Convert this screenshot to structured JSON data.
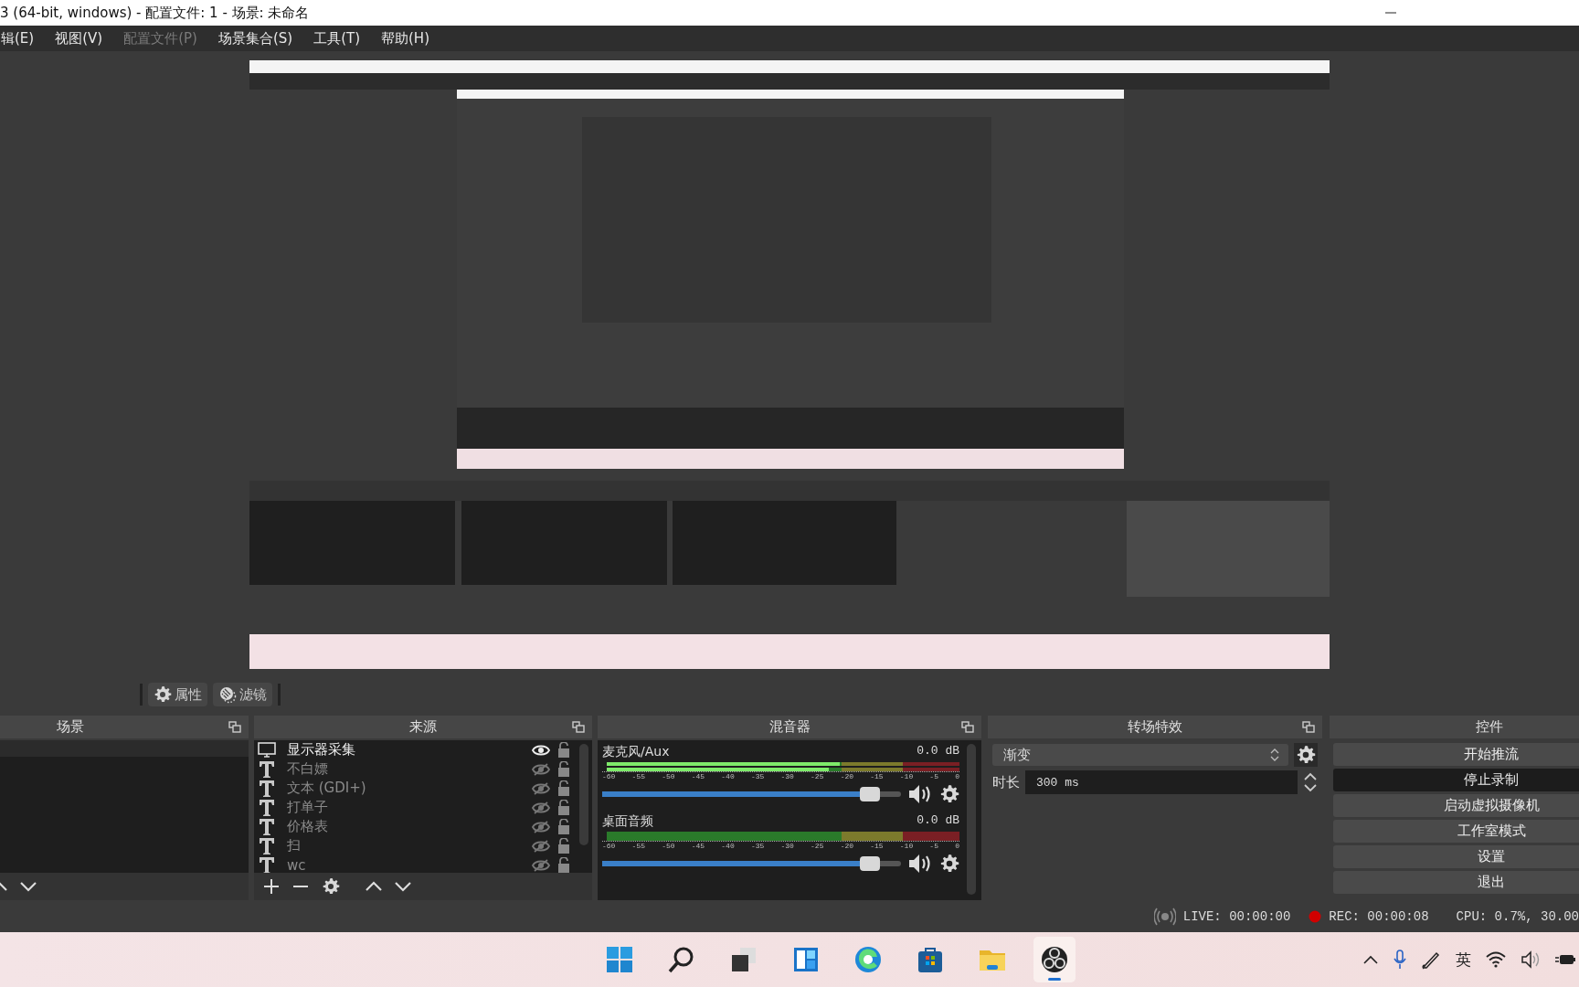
{
  "window": {
    "title": "3 (64-bit, windows) - 配置文件: 1 - 场景: 未命名"
  },
  "menu": [
    {
      "label": "辑(E)",
      "disabled": false
    },
    {
      "label": "视图(V)",
      "disabled": false
    },
    {
      "label": "配置文件(P)",
      "disabled": true
    },
    {
      "label": "场景集合(S)",
      "disabled": false
    },
    {
      "label": "工具(T)",
      "disabled": false
    },
    {
      "label": "帮助(H)",
      "disabled": false
    }
  ],
  "toolbar": [
    {
      "label": "属性",
      "kind": "gear"
    },
    {
      "label": "滤镜",
      "kind": "filter"
    }
  ],
  "scenes": {
    "title": "场景"
  },
  "sources": {
    "title": "来源",
    "items": [
      {
        "name": "显示器采集",
        "kind": "display",
        "visible": true
      },
      {
        "name": "不白嫖",
        "kind": "text",
        "visible": false
      },
      {
        "name": "文本 (GDI+)",
        "kind": "text",
        "visible": false
      },
      {
        "name": "打单子",
        "kind": "text",
        "visible": false
      },
      {
        "name": "价格表",
        "kind": "text",
        "visible": false
      },
      {
        "name": "扫",
        "kind": "text",
        "visible": false
      },
      {
        "name": "wc",
        "kind": "text",
        "visible": false
      }
    ]
  },
  "mixer": {
    "title": "混音器",
    "channels": [
      {
        "name": "麦克风/Aux",
        "reading": "0.0 dB",
        "meters": [
          {
            "level": 0.66
          },
          {
            "level": 0.63
          }
        ],
        "scale": [
          "-60",
          "-55",
          "-50",
          "-45",
          "-40",
          "-35",
          "-30",
          "-25",
          "-20",
          "-15",
          "-10",
          "-5",
          "0"
        ],
        "level": 0.93
      },
      {
        "name": "桌面音频",
        "reading": "0.0 dB",
        "meters": [
          {
            "level": 0
          }
        ],
        "scale": [
          "-60",
          "-55",
          "-50",
          "-45",
          "-40",
          "-35",
          "-30",
          "-25",
          "-20",
          "-15",
          "-10",
          "-5",
          "0"
        ],
        "level": 0.93
      }
    ]
  },
  "transitions": {
    "title": "转场特效",
    "effect": "渐变",
    "duration_label": "时长",
    "duration": "300 ms"
  },
  "controls": {
    "title": "控件",
    "buttons": [
      {
        "label": "开始推流",
        "on": false
      },
      {
        "label": "停止录制",
        "on": true
      },
      {
        "label": "启动虚拟摄像机",
        "on": false
      },
      {
        "label": "工作室模式",
        "on": false
      },
      {
        "label": "设置",
        "on": false
      },
      {
        "label": "退出",
        "on": false
      }
    ]
  },
  "status_bar": {
    "live": "LIVE: 00:00:00",
    "rec": "REC: 00:00:08",
    "cpu": "CPU: 0.7%, 30.00"
  },
  "taskbar": {
    "apps": [
      {
        "kind": "start"
      },
      {
        "kind": "search"
      },
      {
        "kind": "taskview"
      },
      {
        "kind": "widgets"
      },
      {
        "kind": "browser"
      },
      {
        "kind": "store"
      },
      {
        "kind": "folder"
      },
      {
        "kind": "obs",
        "selected": true
      }
    ],
    "input_method": "英"
  }
}
